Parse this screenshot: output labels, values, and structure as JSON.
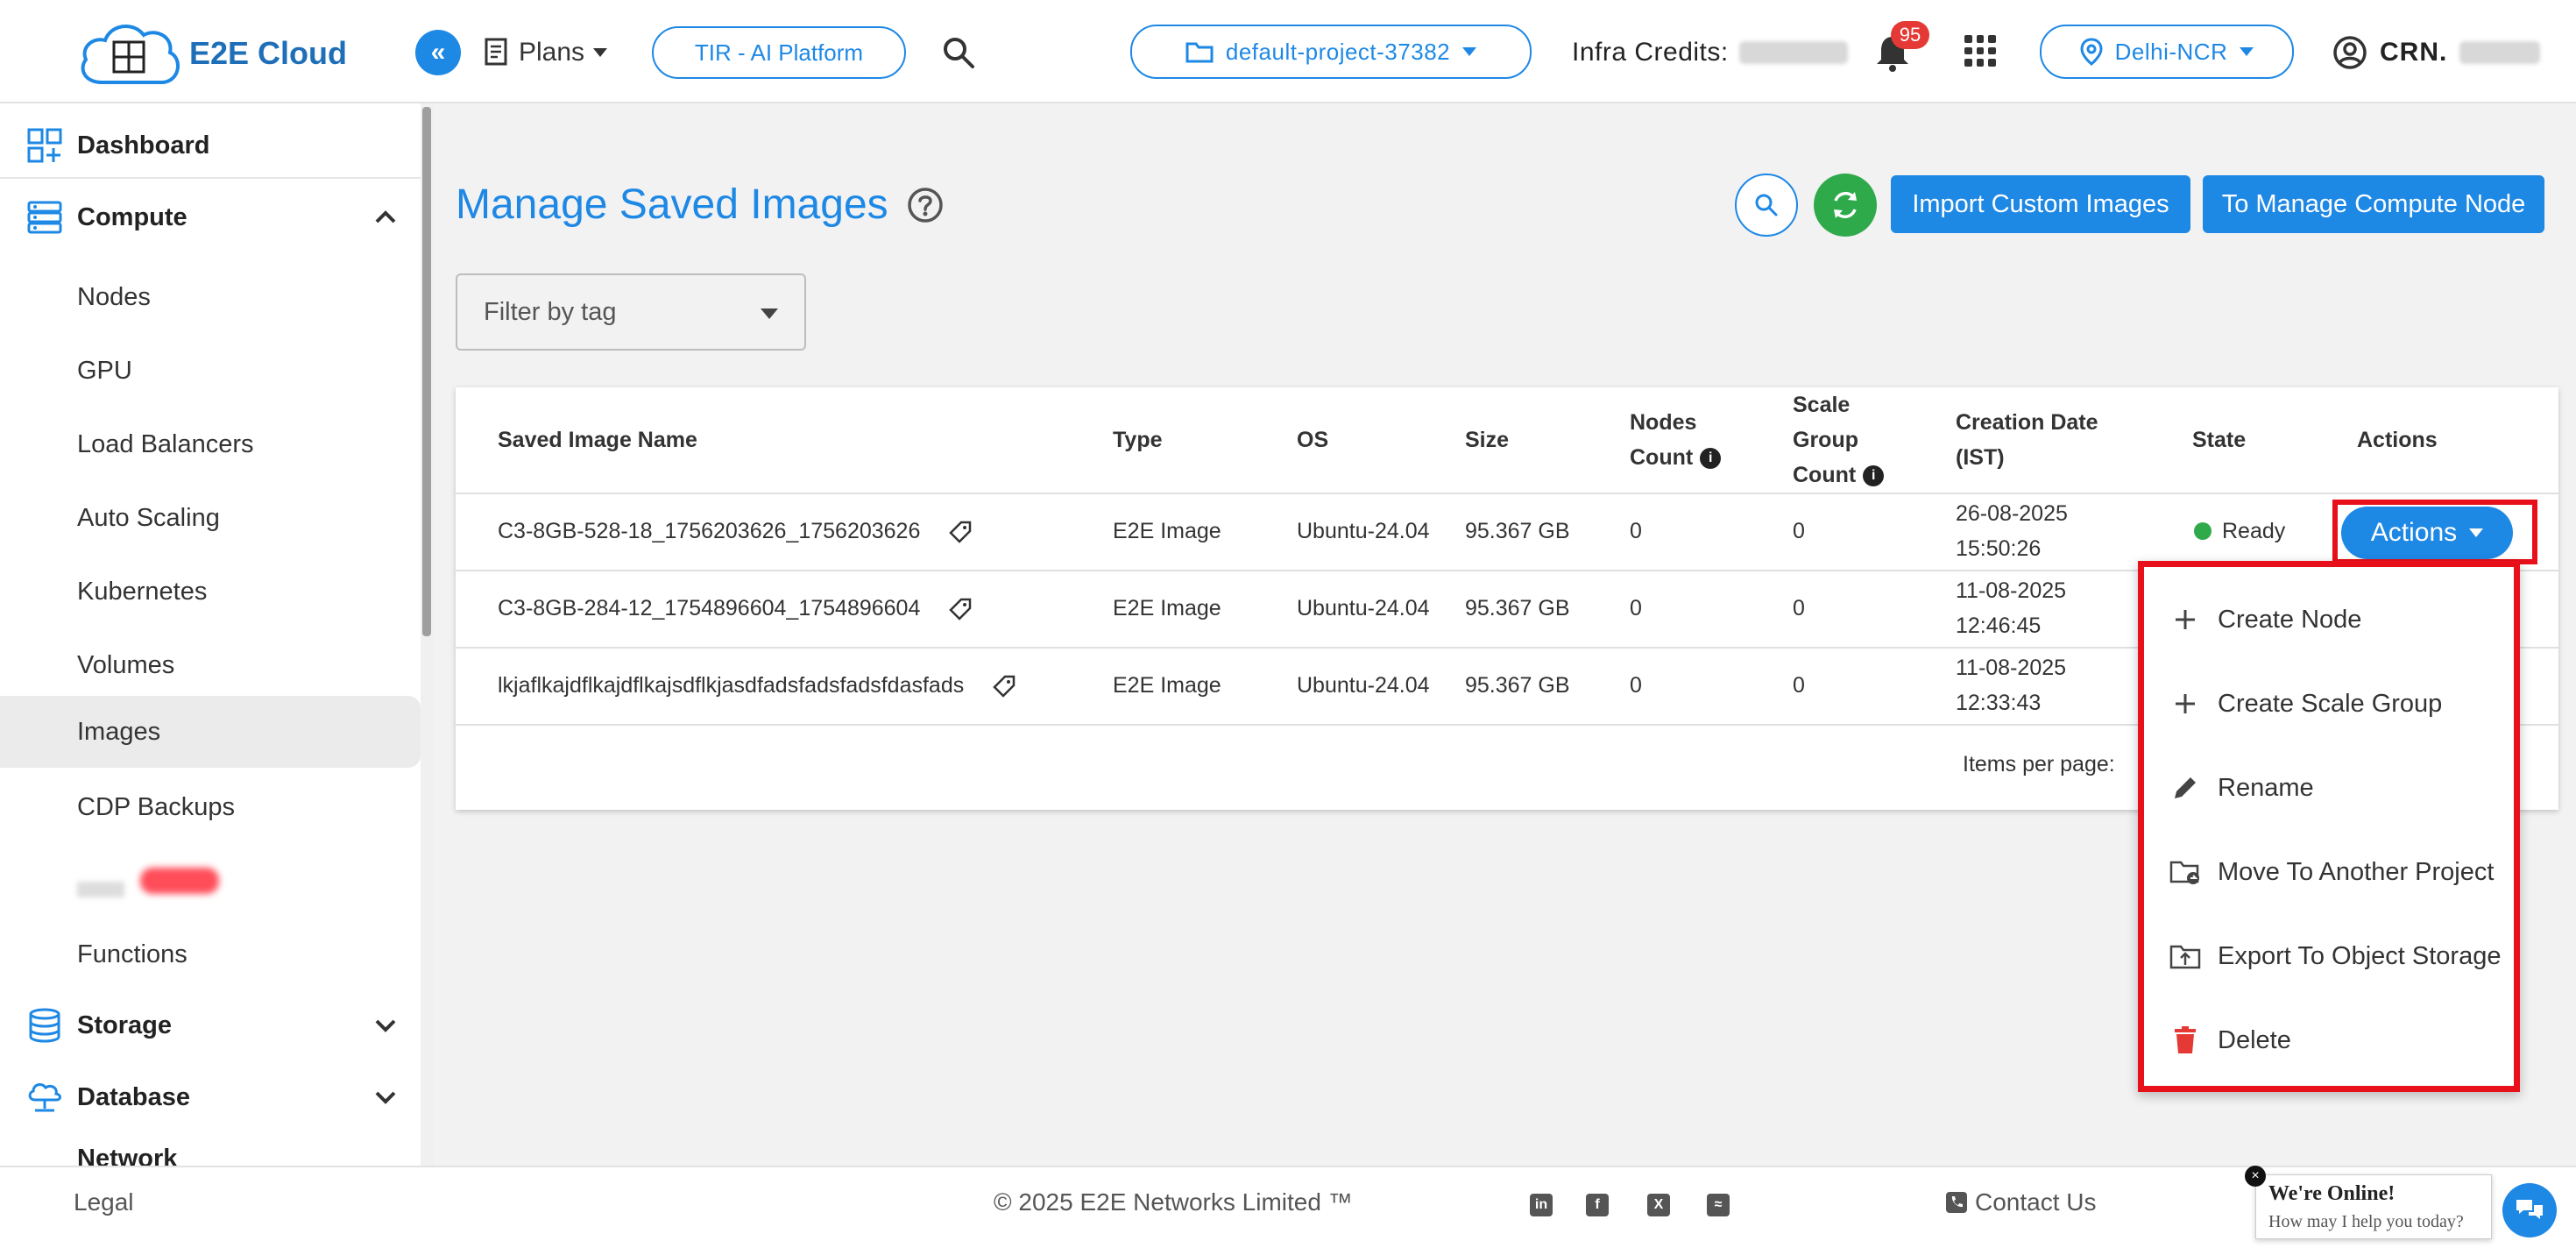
{
  "header": {
    "brand": "E2E Cloud",
    "logo_small_text": "E2E Cloud",
    "plans_label": "Plans",
    "tir_label": "TIR - AI Platform",
    "project_label": "default-project-37382",
    "credits_label": "Infra Credits:",
    "notifications_count": "95",
    "region_label": "Delhi-NCR",
    "crn_label": "CRN."
  },
  "sidebar": {
    "dashboard": "Dashboard",
    "compute": "Compute",
    "items": [
      "Nodes",
      "GPU",
      "Load Balancers",
      "Auto Scaling",
      "Kubernetes",
      "Volumes",
      "Images",
      "CDP Backups",
      "",
      "Functions"
    ],
    "storage": "Storage",
    "database": "Database",
    "network": "Network",
    "active_item": "Images"
  },
  "main": {
    "title": "Manage Saved Images",
    "import_button": "Import Custom Images",
    "manage_button": "To Manage Compute Node",
    "filter_placeholder": "Filter by tag"
  },
  "table": {
    "headers": {
      "name": "Saved Image Name",
      "type": "Type",
      "os": "OS",
      "size": "Size",
      "nodes_count_1": "Nodes",
      "nodes_count_2": "Count",
      "scale_1": "Scale",
      "scale_2": "Group",
      "scale_3": "Count",
      "date_1": "Creation Date",
      "date_2": "(IST)",
      "state": "State",
      "actions": "Actions"
    },
    "rows": [
      {
        "name": "C3-8GB-528-18_1756203626_1756203626",
        "type": "E2E Image",
        "os": "Ubuntu-24.04",
        "size": "95.367 GB",
        "nodes": "0",
        "scale": "0",
        "date": "26-08-2025",
        "time": "15:50:26",
        "state": "Ready"
      },
      {
        "name": "C3-8GB-284-12_1754896604_1754896604",
        "type": "E2E Image",
        "os": "Ubuntu-24.04",
        "size": "95.367 GB",
        "nodes": "0",
        "scale": "0",
        "date": "11-08-2025",
        "time": "12:46:45",
        "state": ""
      },
      {
        "name": "lkjaflkajdflkajdflkajsdflkjasdfadsfadsfadsfdasfads",
        "type": "E2E Image",
        "os": "Ubuntu-24.04",
        "size": "95.367 GB",
        "nodes": "0",
        "scale": "0",
        "date": "11-08-2025",
        "time": "12:33:43",
        "state": ""
      }
    ],
    "items_per_page": "Items per page:",
    "actions_button": "Actions"
  },
  "actions_menu": [
    {
      "label": "Create Node",
      "icon": "plus-icon"
    },
    {
      "label": "Create Scale Group",
      "icon": "plus-icon"
    },
    {
      "label": "Rename",
      "icon": "pencil-icon"
    },
    {
      "label": "Move To Another Project",
      "icon": "folder-move-icon"
    },
    {
      "label": "Export To Object Storage",
      "icon": "folder-upload-icon"
    },
    {
      "label": "Delete",
      "icon": "trash-icon"
    }
  ],
  "footer": {
    "legal": "Legal",
    "copyright": "© 2025 E2E Networks Limited ™",
    "contact": "Contact Us",
    "chat_title": "We're Online!",
    "chat_subtitle": "How may I help you today?"
  },
  "colors": {
    "accent": "#1e88e5",
    "success": "#2eaa4a",
    "highlight": "#e8101a",
    "danger": "#e53935"
  }
}
